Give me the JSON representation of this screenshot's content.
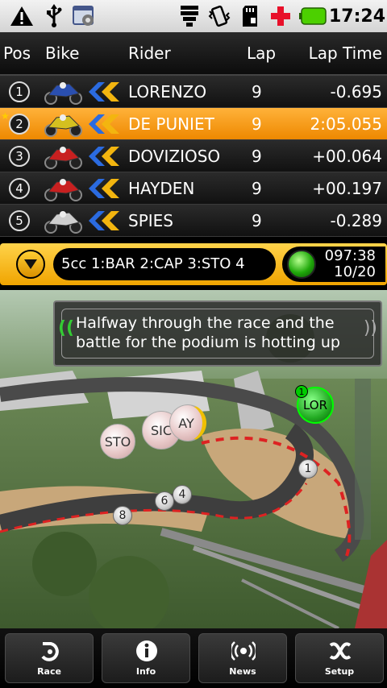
{
  "status_bar": {
    "time": "17:24",
    "icons": [
      "warning-icon",
      "usb-icon",
      "sync-icon",
      "wifi-icon",
      "vibrate-icon",
      "sd-card-icon",
      "plus-icon",
      "battery-icon"
    ],
    "accent_red": "#e8102a",
    "battery_green": "#4cd000"
  },
  "table": {
    "headers": {
      "pos": "Pos",
      "bike": "Bike",
      "rider": "Rider",
      "lap": "Lap",
      "lap_time": "Lap Time"
    },
    "rows": [
      {
        "pos": "1",
        "rider": "LORENZO",
        "lap": "9",
        "lap_time": "-0.695",
        "bike_color": "#2a4fb0",
        "highlight": false
      },
      {
        "pos": "2",
        "rider": "DE PUNIET",
        "lap": "9",
        "lap_time": "2:05.055",
        "bike_color": "#d4c020",
        "highlight": true
      },
      {
        "pos": "3",
        "rider": "DOVIZIOSO",
        "lap": "9",
        "lap_time": "+00.064",
        "bike_color": "#c82020",
        "highlight": false
      },
      {
        "pos": "4",
        "rider": "HAYDEN",
        "lap": "9",
        "lap_time": "+00.197",
        "bike_color": "#c82020",
        "highlight": false
      },
      {
        "pos": "5",
        "rider": "SPIES",
        "lap": "9",
        "lap_time": "-0.289",
        "bike_color": "#cfcfcf",
        "highlight": false
      }
    ]
  },
  "ticker": {
    "scroll_text": "5cc 1:BAR  2:CAP  3:STO  4",
    "race_time": "097:38",
    "lap_progress": "10/20",
    "light_color": "#22b010"
  },
  "map": {
    "message": "Halfway through the race and the battle for the podium is hotting up",
    "leader_tag": "LOR",
    "leader_position": "1",
    "rider_tags": [
      "STO",
      "SIC",
      "AY"
    ],
    "number_tags": [
      "1",
      "4",
      "6",
      "8"
    ]
  },
  "bottom_nav": [
    {
      "label": "Race",
      "icon": "race-icon"
    },
    {
      "label": "Info",
      "icon": "info-icon"
    },
    {
      "label": "News",
      "icon": "news-icon"
    },
    {
      "label": "Setup",
      "icon": "setup-icon"
    }
  ]
}
